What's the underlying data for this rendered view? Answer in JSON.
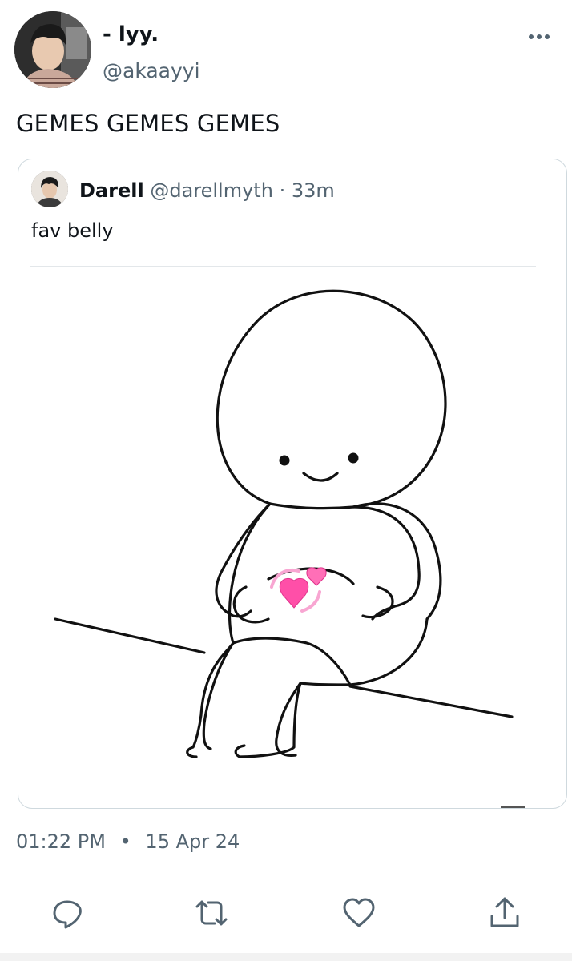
{
  "author": {
    "display_name": "- lyy.",
    "handle": "@akaayyi",
    "avatar_icon": "user-avatar"
  },
  "tweet": {
    "text": "GEMES GEMES GEMES",
    "time": "01:22 PM",
    "separator": "•",
    "date": "15 Apr 24"
  },
  "quoted_tweet": {
    "display_name": "Darell",
    "handle": "@darellmyth",
    "separator": "·",
    "time_ago": "33m",
    "text": "fav belly",
    "media": {
      "emoji": "💞"
    }
  },
  "actions": [
    {
      "name": "reply",
      "icon": "reply-icon"
    },
    {
      "name": "retweet",
      "icon": "retweet-icon"
    },
    {
      "name": "like",
      "icon": "heart-icon"
    },
    {
      "name": "share",
      "icon": "share-icon"
    }
  ],
  "colors": {
    "text": "#0f1419",
    "secondary": "#536471",
    "border": "#cfd9de",
    "heart_pink": "#ff4fa8"
  }
}
